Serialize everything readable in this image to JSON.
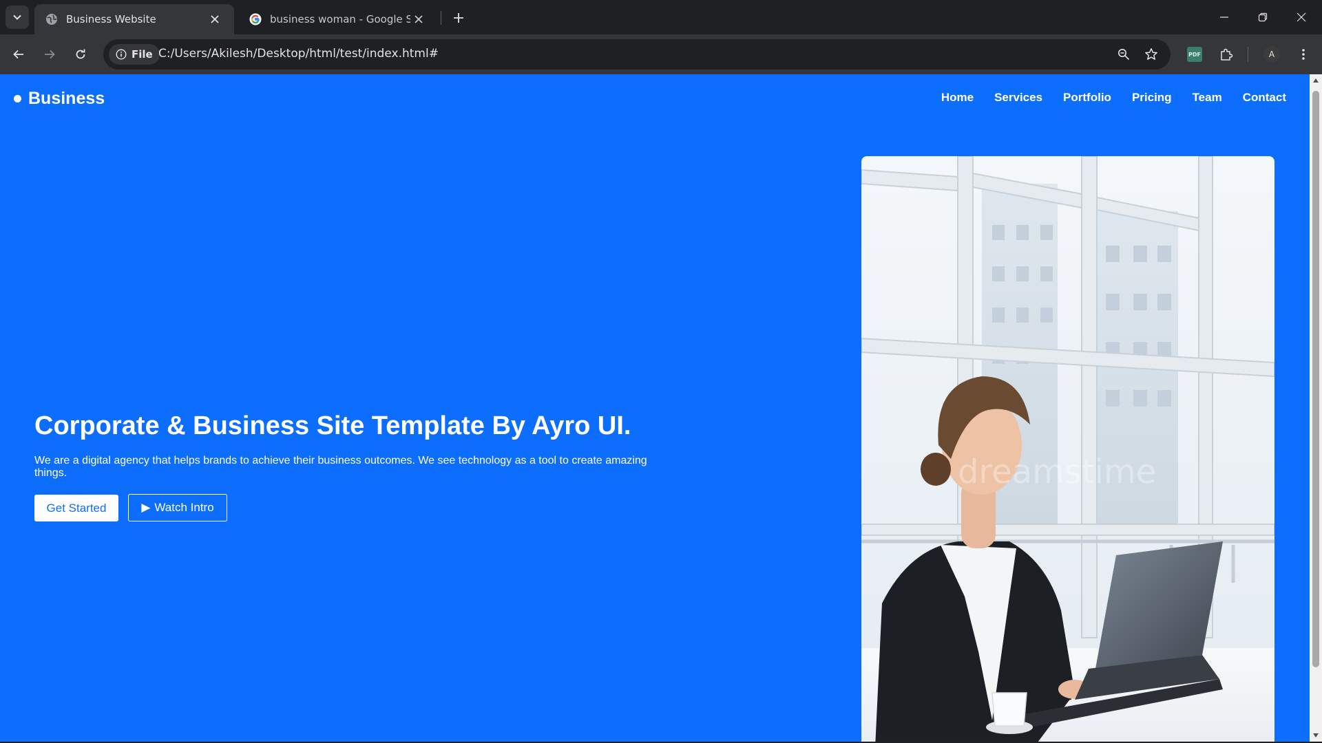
{
  "browser": {
    "tabs": [
      {
        "title": "Business Website",
        "active": true,
        "favicon": "globe-icon"
      },
      {
        "title": "business woman - Google Search",
        "active": false,
        "favicon": "google-icon"
      }
    ],
    "address": {
      "scheme_chip": "File",
      "url": "C:/Users/Akilesh/Desktop/html/test/index.html#"
    },
    "profile_initial": "A",
    "pdf_extension_label": "PDF"
  },
  "page": {
    "brand": "Business",
    "nav": [
      "Home",
      "Services",
      "Portfolio",
      "Pricing",
      "Team",
      "Contact"
    ],
    "hero": {
      "title": "Corporate & Business Site Template By Ayro UI.",
      "description": "We are a digital agency that helps brands to achieve their business outcomes. We see technology as a tool to create amazing things.",
      "primary_button": "Get Started",
      "secondary_button": "Watch Intro",
      "secondary_button_icon": "▶",
      "image_alt": "Business woman working on a laptop in an office",
      "watermark": "dreamstime"
    },
    "colors": {
      "brand_blue": "#0d6efd",
      "white": "#ffffff"
    }
  }
}
